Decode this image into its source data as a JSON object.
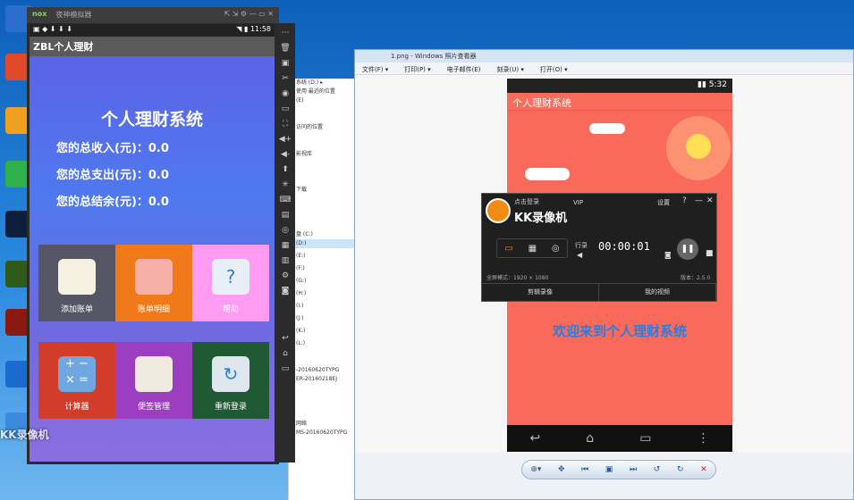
{
  "desktop": {
    "watermark": "KK录像机"
  },
  "nox": {
    "brand": "nox",
    "title": "夜神模拟器",
    "status_time": "11:58"
  },
  "app": {
    "bar_title": "ZBL个人理财",
    "heading": "个人理财系统",
    "stats": [
      {
        "label": "您的总收入(元)：",
        "value": "0.0"
      },
      {
        "label": "您的总支出(元)：",
        "value": "0.0"
      },
      {
        "label": "您的总结余(元)：",
        "value": "0.0"
      }
    ],
    "tiles": [
      {
        "label": "添加账单",
        "color": "#555566"
      },
      {
        "label": "账单明细",
        "color": "#f07a1a"
      },
      {
        "label": "帮助",
        "color": "#ff9cf2"
      },
      {
        "label": "计算器",
        "color": "#d23c2a"
      },
      {
        "label": "便签管理",
        "color": "#9b3fc0"
      },
      {
        "label": "重新登录",
        "color": "#1f5a34"
      }
    ]
  },
  "viewer": {
    "title": "1.png - Windows 照片查看器",
    "menu": [
      "文件(F) ▾",
      "打印(P) ▾",
      "电子邮件(E)",
      "刻录(U) ▾",
      "打开(O) ▾"
    ]
  },
  "phone2": {
    "status_time": "5:32",
    "title": "个人理财系统",
    "welcome": "欢迎来到个人理财系统"
  },
  "kk": {
    "login": "点击登录",
    "vip": "VIP",
    "name": "KK录像机",
    "settings": "设置",
    "record_label": "行录",
    "time": "00:00:01",
    "resolution": "全屏模式：1920 × 1080",
    "version": "版本：2.5.0",
    "btn_left": "剪辑录像",
    "btn_right": "我的视频"
  },
  "explorer": {
    "items": [
      "系统 (D:) ▸",
      "使用 最近的位置",
      "(E)",
      "访问的位置",
      "影视库",
      "下载",
      "盘 (C:)",
      "(D:)",
      "(E:)",
      "(F:)",
      "(G:)",
      "(H:)",
      "(I:)",
      "(J:)",
      "(K:)",
      "(L:)"
    ],
    "footer": [
      "-20160620TYPG",
      "ER-20160218EJ",
      "网络",
      "MS-20160620TYPG"
    ]
  }
}
